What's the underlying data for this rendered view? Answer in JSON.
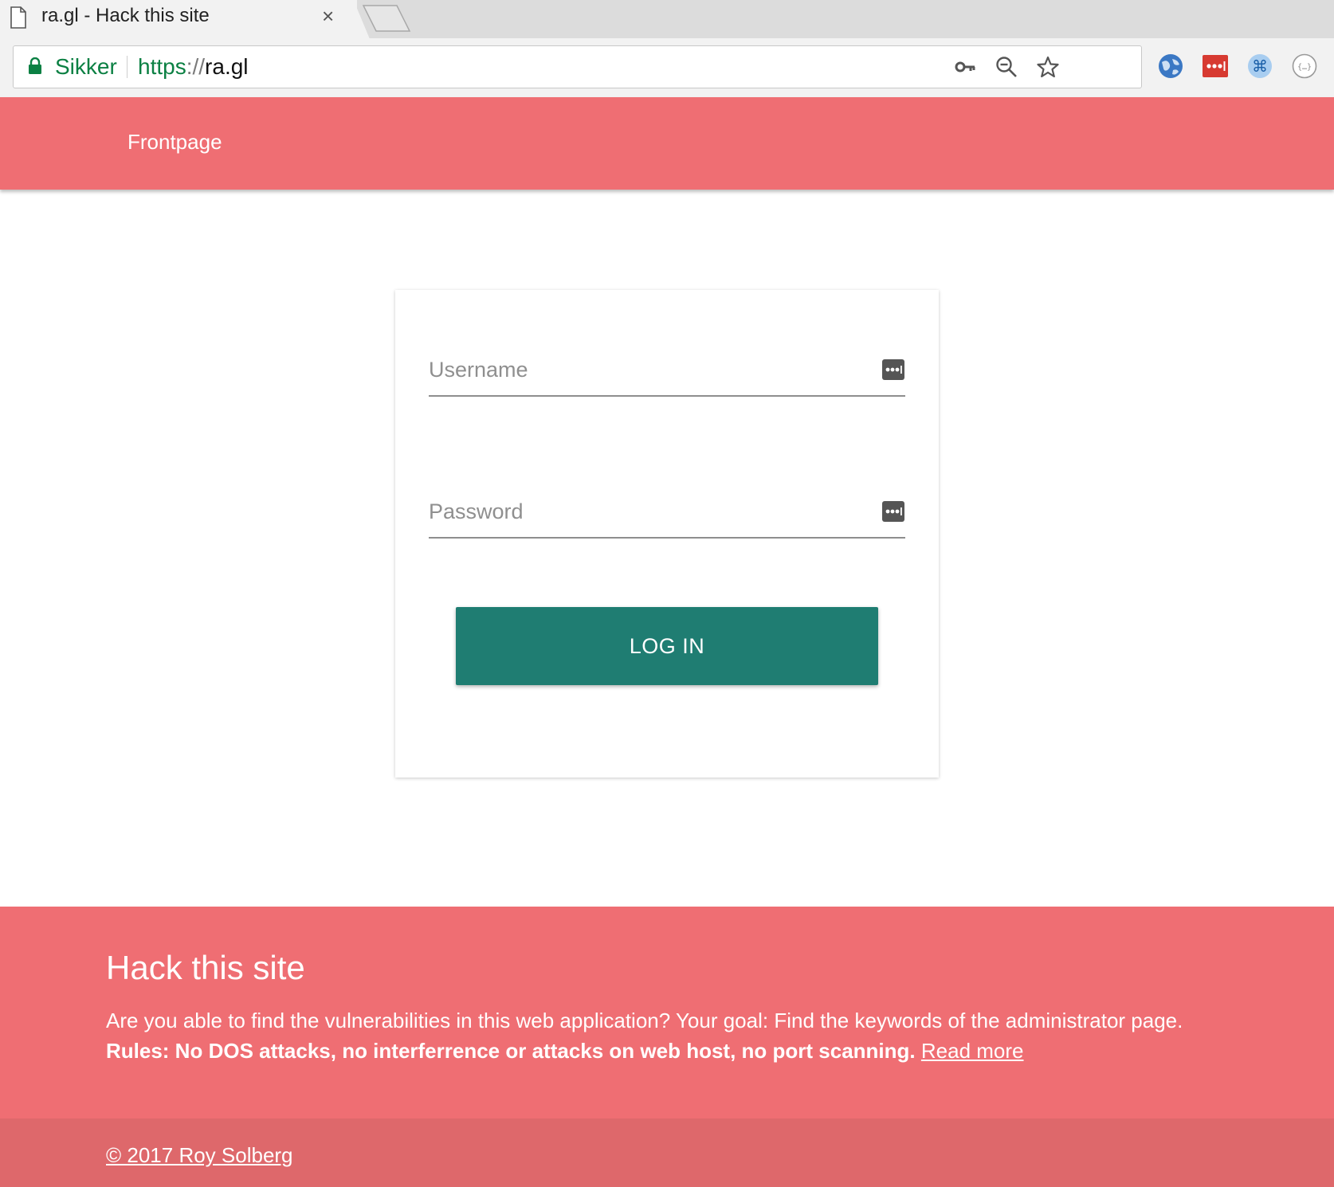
{
  "browser": {
    "tab_title": "ra.gl - Hack this site",
    "tab_close": "×",
    "secure_label": "Sikker",
    "url_scheme": "https",
    "url_separator": "://",
    "url_host": "ra.gl"
  },
  "header": {
    "nav_label": "Frontpage"
  },
  "login": {
    "username_placeholder": "Username",
    "password_placeholder": "Password",
    "submit_label": "LOG IN"
  },
  "footer": {
    "title": "Hack this site",
    "description": "Are you able to find the vulnerabilities in this web application? Your goal: Find the keywords of the administrator page.",
    "rules": "Rules: No DOS attacks, no interferrence or attacks on web host, no port scanning.",
    "read_more": "Read more",
    "copyright": "© 2017 Roy Solberg"
  },
  "colors": {
    "brand": "#ef6e73",
    "brand_dark": "#de686b",
    "button": "#1f7d72",
    "secure": "#0b8043"
  },
  "icons": {
    "tab": "file-icon",
    "secure": "lock-icon",
    "omnibox": [
      "key-icon",
      "zoom-out-icon",
      "star-icon"
    ],
    "extensions": [
      "globe-extension-icon",
      "lastpass-extension-icon",
      "command-extension-icon",
      "json-extension-icon"
    ],
    "password_field": "password-manager-icon"
  }
}
